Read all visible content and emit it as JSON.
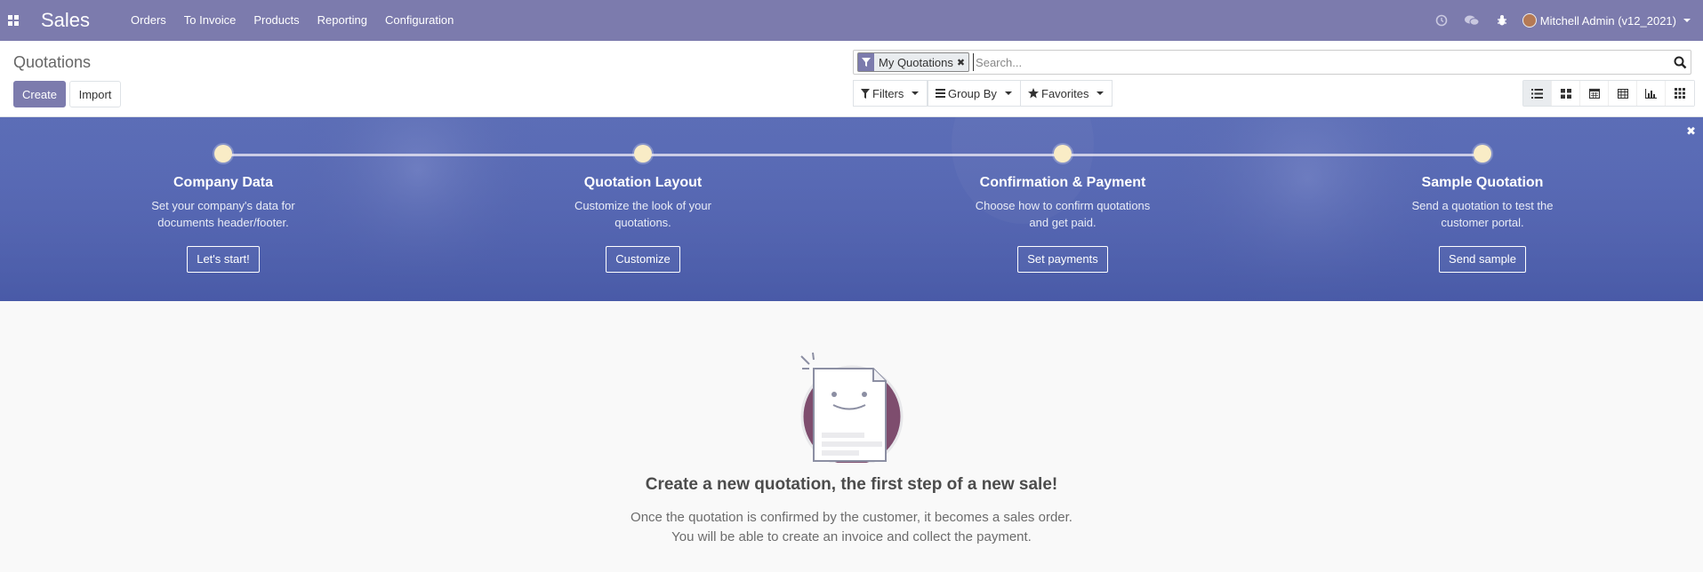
{
  "navbar": {
    "brand": "Sales",
    "menu": [
      "Orders",
      "To Invoice",
      "Products",
      "Reporting",
      "Configuration"
    ],
    "user": "Mitchell Admin (v12_2021)",
    "systray_icons": [
      "clock-icon",
      "chat-icon",
      "bug-icon"
    ]
  },
  "control_panel": {
    "title": "Quotations",
    "create_label": "Create",
    "import_label": "Import",
    "search": {
      "facet": "My Quotations",
      "placeholder": "Search..."
    },
    "filters_label": "Filters",
    "groupby_label": "Group By",
    "favorites_label": "Favorites",
    "views": [
      "list",
      "kanban",
      "calendar",
      "pivot",
      "graph",
      "activity"
    ],
    "active_view": "list"
  },
  "onboarding": {
    "steps": [
      {
        "title": "Company Data",
        "desc": "Set your company's data for documents header/footer.",
        "button": "Let's start!"
      },
      {
        "title": "Quotation Layout",
        "desc": "Customize the look of your quotations.",
        "button": "Customize"
      },
      {
        "title": "Confirmation & Payment",
        "desc": "Choose how to confirm quotations and get paid.",
        "button": "Set payments"
      },
      {
        "title": "Sample Quotation",
        "desc": "Send a quotation to test the customer portal.",
        "button": "Send sample"
      }
    ]
  },
  "empty_state": {
    "title": "Create a new quotation, the first step of a new sale!",
    "line1": "Once the quotation is confirmed by the customer, it becomes a sales order.",
    "line2": "You will be able to create an invoice and collect the payment."
  },
  "colors": {
    "brand": "#7c7bad",
    "banner": "#5565a8",
    "step_dot": "#f9ecc6",
    "illustration_circle": "#7e4d6e"
  }
}
